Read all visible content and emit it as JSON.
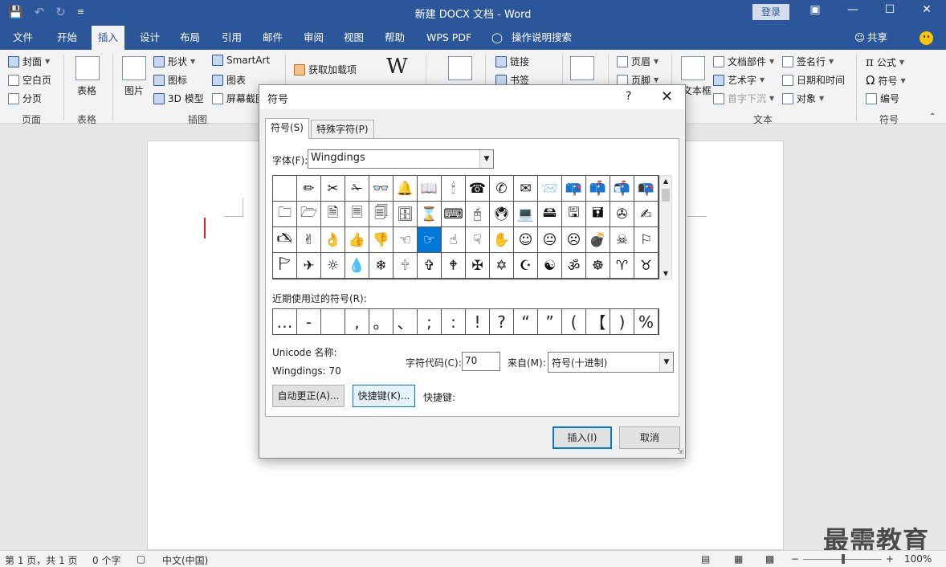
{
  "window": {
    "title": "新建 DOCX 文档  -  Word",
    "login_label": "登录",
    "qat_icons": [
      "save-icon",
      "undo-icon",
      "redo-icon",
      "customize-icon"
    ]
  },
  "menu": {
    "tabs": [
      "文件",
      "开始",
      "插入",
      "设计",
      "布局",
      "引用",
      "邮件",
      "审阅",
      "视图",
      "帮助",
      "WPS PDF"
    ],
    "active_tab": "插入",
    "tell_me": "操作说明搜索",
    "share": "共享"
  },
  "ribbon": {
    "page_group": {
      "label": "页面",
      "items": [
        "封面",
        "空白页",
        "分页"
      ]
    },
    "table_group": {
      "label": "表格",
      "button": "表格"
    },
    "illustrations_group": {
      "label": "插图",
      "picture": "图片",
      "items": [
        "形状",
        "图标",
        "3D 模型",
        "SmartArt",
        "图表",
        "屏幕截图"
      ]
    },
    "addins": {
      "label": "获取加载项"
    },
    "links": [
      "链接",
      "书签"
    ],
    "header_footer": [
      "页眉",
      "页脚"
    ],
    "text_group": {
      "label": "文本",
      "textbox": "文本框",
      "items": [
        "文档部件",
        "艺术字",
        "首字下沉",
        "签名行",
        "日期和时间",
        "对象"
      ]
    },
    "symbols_group": {
      "label": "符号",
      "items": [
        "公式",
        "符号",
        "编号"
      ]
    }
  },
  "dialog": {
    "title": "符号",
    "help": "?",
    "tabs": [
      "符号(S)",
      "特殊字符(P)"
    ],
    "font_label": "字体(F):",
    "font_value": "Wingdings",
    "symbols": [
      "",
      "✏",
      "✂",
      "✁",
      "👓",
      "🔔",
      "📖",
      "🕯",
      "☎",
      "✆",
      "✉",
      "📨",
      "📪",
      "📫",
      "📬",
      "📭",
      "🗀",
      "🗁",
      "🗎",
      "🗏",
      "🗐",
      "🗄",
      "⌛",
      "⌨",
      "🖰",
      "🖲",
      "💻",
      "🖴",
      "🖫",
      "🖬",
      "✇",
      "✍",
      "🖎",
      "✌",
      "👌",
      "👍",
      "👎",
      "☜",
      "☞",
      "☝",
      "☟",
      "✋",
      "☺",
      "😐",
      "☹",
      "💣",
      "☠",
      "⚐",
      "🏱",
      "✈",
      "☼",
      "💧",
      "❄",
      "🕆",
      "✞",
      "🕈",
      "✠",
      "✡",
      "☪",
      "☯",
      "ॐ",
      "☸",
      "♈",
      "♉"
    ],
    "selected_index": 38,
    "recent_label": "近期使用过的符号(R):",
    "recent": [
      "…",
      "-",
      "",
      ",",
      "。",
      "、",
      ";",
      ":",
      "!",
      "?",
      "“",
      "”",
      "(",
      "【",
      ")",
      "%"
    ],
    "unicode_name_label": "Unicode 名称:",
    "unicode_name_value": "Wingdings: 70",
    "char_code_label": "字符代码(C):",
    "char_code_value": "70",
    "from_label": "来自(M):",
    "from_value": "符号(十进制)",
    "autocorrect_button": "自动更正(A)...",
    "shortcut_key_button": "快捷键(K)...",
    "shortcut_label": "快捷键:",
    "insert_button": "插入(I)",
    "cancel_button": "取消"
  },
  "status": {
    "page": "第 1 页，共 1 页",
    "words": "0 个字",
    "language": "中文(中国)",
    "zoom": "100%",
    "zoom_minus": "−",
    "zoom_plus": "+"
  },
  "watermark": "最需教育",
  "colors": {
    "brand": "#2b579a",
    "selection": "#0078d7",
    "cursor": "#e02020"
  }
}
